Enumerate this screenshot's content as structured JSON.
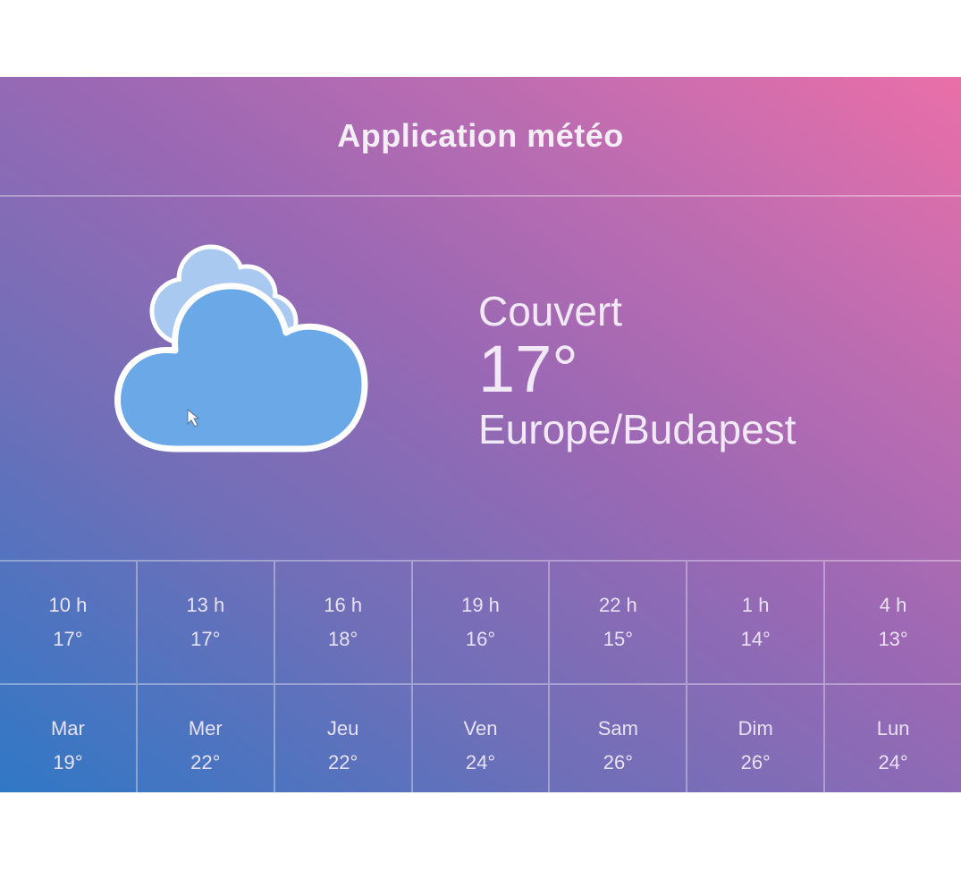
{
  "app": {
    "title": "Application météo"
  },
  "current": {
    "icon": "cloudy-icon",
    "condition": "Couvert",
    "temperature": "17°",
    "timezone": "Europe/Budapest"
  },
  "hourly": [
    {
      "time": "10 h",
      "temp": "17°"
    },
    {
      "time": "13 h",
      "temp": "17°"
    },
    {
      "time": "16 h",
      "temp": "18°"
    },
    {
      "time": "19 h",
      "temp": "16°"
    },
    {
      "time": "22 h",
      "temp": "15°"
    },
    {
      "time": "1 h",
      "temp": "14°"
    },
    {
      "time": "4 h",
      "temp": "13°"
    }
  ],
  "daily": [
    {
      "day": "Mar",
      "temp": "19°"
    },
    {
      "day": "Mer",
      "temp": "22°"
    },
    {
      "day": "Jeu",
      "temp": "22°"
    },
    {
      "day": "Ven",
      "temp": "24°"
    },
    {
      "day": "Sam",
      "temp": "26°"
    },
    {
      "day": "Dim",
      "temp": "26°"
    },
    {
      "day": "Lun",
      "temp": "24°"
    }
  ],
  "colors": {
    "gradient_start": "#2f78c6",
    "gradient_end": "#ea6fa8",
    "cloud_fill": "#6aa8e8",
    "cloud_back_fill": "#a9c9f1",
    "text": "#f1e9f5"
  }
}
